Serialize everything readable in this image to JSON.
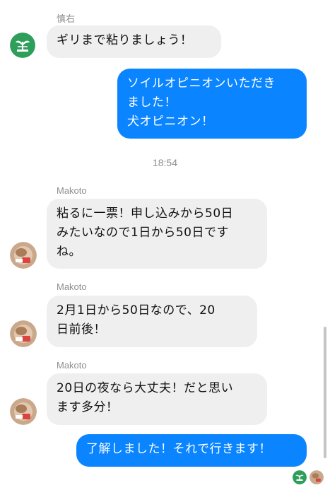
{
  "messages": [
    {
      "sender": "慎右",
      "text": "ギリまで粘りましょう！"
    },
    {
      "sender": "",
      "text": "ソイルオピニオンいただき\nました！\n犬オピニオン！"
    },
    {
      "sender": "Makoto",
      "text": "粘るに一票！申し込みから50日\nみたいなので1日から50日です\nね。"
    },
    {
      "sender": "Makoto",
      "text": "2月1日から50日なので、20\n日前後！"
    },
    {
      "sender": "Makoto",
      "text": "20日の夜なら大丈夫！だと思い\nます多分！"
    },
    {
      "sender": "",
      "text": "了解しました！それで行きます！"
    }
  ],
  "timestamp": "18:54",
  "colors": {
    "outgoing": "#0a84ff",
    "incoming": "#efefef",
    "brand_green": "#2e9e5b"
  },
  "icons": {
    "green_avatar": "sprout-logo-icon",
    "photo_avatar": "photo-avatar"
  }
}
